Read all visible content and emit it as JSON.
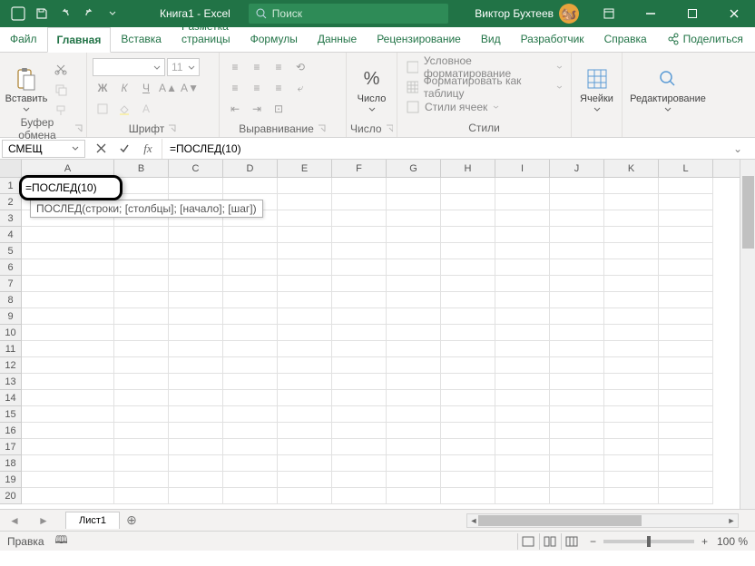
{
  "titlebar": {
    "document_title": "Книга1 - Excel",
    "search_placeholder": "Поиск",
    "user_name": "Виктор Бухтеев"
  },
  "tabs": {
    "file": "Файл",
    "home": "Главная",
    "insert": "Вставка",
    "page_layout": "Разметка страницы",
    "formulas": "Формулы",
    "data": "Данные",
    "review": "Рецензирование",
    "view": "Вид",
    "developer": "Разработчик",
    "help": "Справка",
    "share": "Поделиться"
  },
  "ribbon": {
    "clipboard": {
      "paste": "Вставить",
      "label": "Буфер обмена"
    },
    "font": {
      "name_placeholder": "",
      "size": "11",
      "label": "Шрифт"
    },
    "alignment": {
      "label": "Выравнивание"
    },
    "number": {
      "button": "Число",
      "label": "Число"
    },
    "styles": {
      "conditional": "Условное форматирование",
      "as_table": "Форматировать как таблицу",
      "cell_styles": "Стили ячеек",
      "label": "Стили"
    },
    "cells": {
      "button": "Ячейки",
      "label": ""
    },
    "editing": {
      "button": "Редактирование",
      "label": ""
    }
  },
  "namebox": {
    "value": "СМЕЩ"
  },
  "formula_bar": {
    "value": "=ПОСЛЕД(10)"
  },
  "active_cell": {
    "value": "=ПОСЛЕД(10)"
  },
  "tooltip": {
    "text": "ПОСЛЕД(строки; [столбцы]; [начало]; [шаг])"
  },
  "columns": [
    "A",
    "B",
    "C",
    "D",
    "E",
    "F",
    "G",
    "H",
    "I",
    "J",
    "K",
    "L"
  ],
  "rows": [
    "1",
    "2",
    "3",
    "4",
    "5",
    "6",
    "7",
    "8",
    "9",
    "10",
    "11",
    "12",
    "13",
    "14",
    "15",
    "16",
    "17",
    "18",
    "19",
    "20"
  ],
  "sheets": {
    "sheet1": "Лист1"
  },
  "statusbar": {
    "mode": "Правка",
    "zoom": "100 %"
  }
}
